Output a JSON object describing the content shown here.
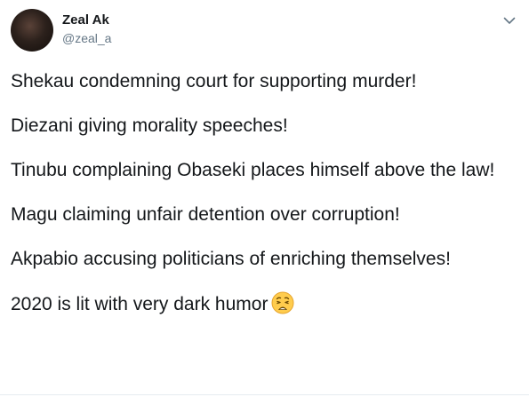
{
  "author": {
    "display_name": "Zeal Ak",
    "handle": "@zeal_a"
  },
  "icons": {
    "menu": "chevron-down-icon",
    "emoji": "weary-face-emoji"
  },
  "tweet": {
    "paragraphs": [
      "Shekau condemning court for supporting murder!",
      "Diezani giving morality speeches!",
      "Tinubu complaining Obaseki places himself above the law!",
      "Magu claiming unfair detention over corruption!",
      "Akpabio accusing politicians of enriching themselves!",
      "2020 is lit with very dark humor"
    ]
  },
  "colors": {
    "text": "#14171a",
    "secondary": "#657786",
    "emoji": "#ffcc4d"
  }
}
